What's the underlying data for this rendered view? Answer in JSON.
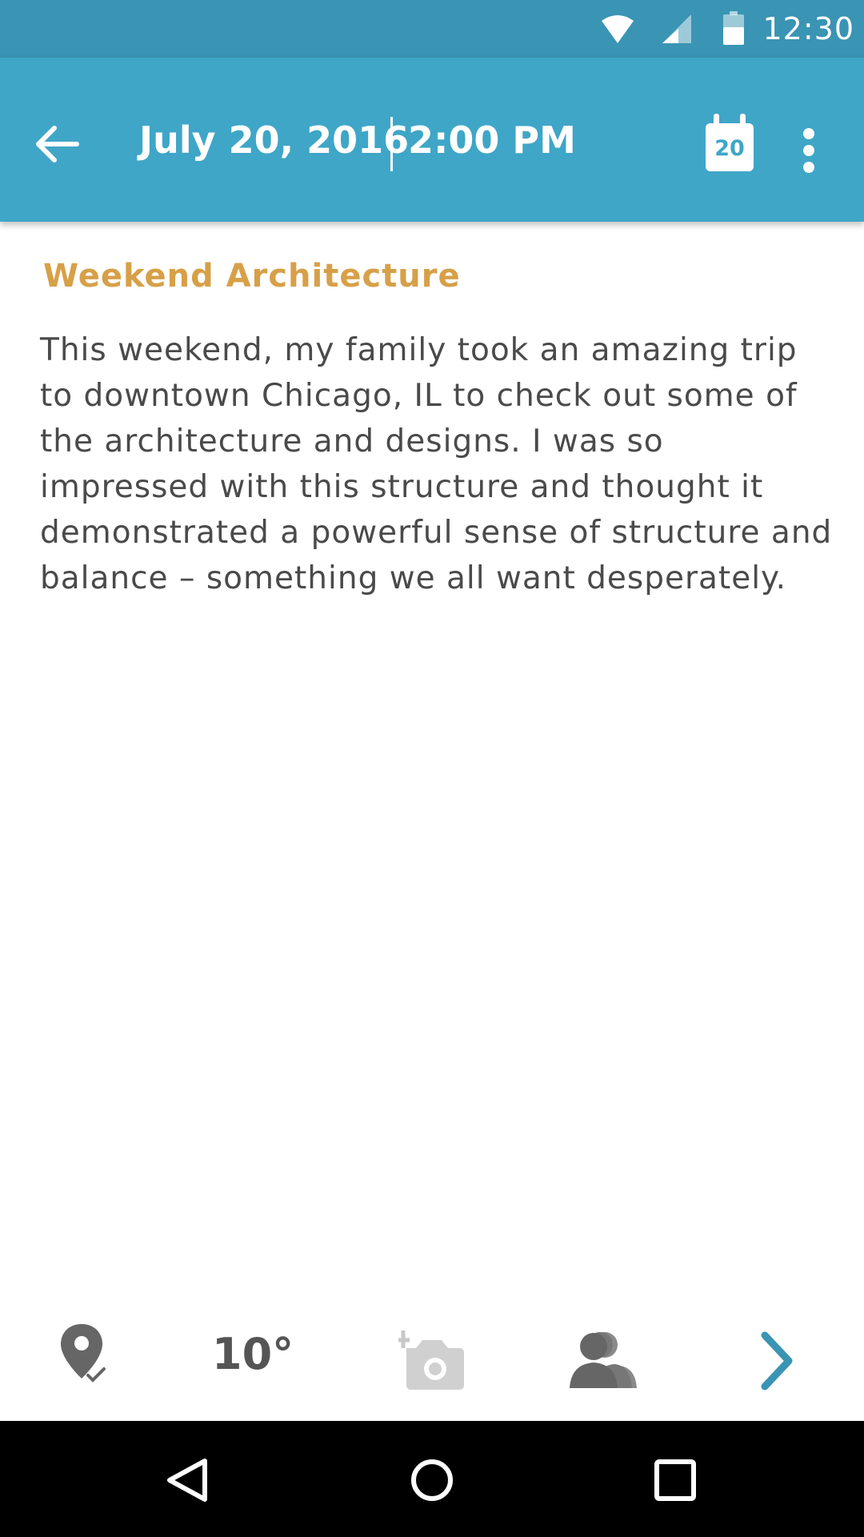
{
  "status_bar": {
    "time": "12:30",
    "icons": [
      "wifi-icon",
      "cell-signal-icon",
      "battery-icon"
    ]
  },
  "header": {
    "date": "July 20, 2016",
    "time": "2:00 PM",
    "calendar_day": "20",
    "icons": [
      "back-arrow-icon",
      "calendar-icon",
      "more-vert-icon"
    ]
  },
  "entry": {
    "title": "Weekend Architecture",
    "body": "This weekend, my family took an amazing trip to downtown Chicago, IL to check out some of the architecture and designs. I was so impressed with this structure and thought it demonstrated a powerful sense of structure and balance – something we all want desperately."
  },
  "toolbar": {
    "temperature": "10°",
    "icons": [
      "location-check-icon",
      "add-photo-icon",
      "people-icon",
      "chevron-right-icon"
    ]
  },
  "nav_bar": {
    "icons": [
      "back-triangle-icon",
      "home-circle-icon",
      "recents-square-icon"
    ]
  },
  "colors": {
    "status_bar": "#3a94b3",
    "app_bar": "#3fa6c7",
    "title": "#d7a048",
    "body_text": "#4a4a4a",
    "toolbar_icons": "#666666",
    "chevron": "#3a94b3"
  }
}
